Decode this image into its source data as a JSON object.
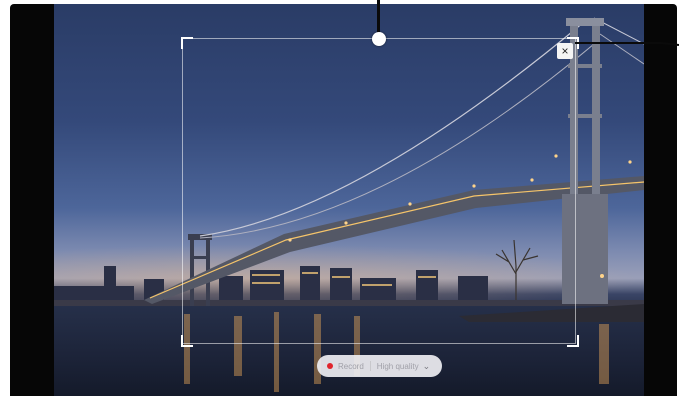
{
  "toolbar": {
    "record_label": "Record",
    "quality_label": "High quality",
    "record_color": "#e0242c"
  },
  "controls": {
    "close_glyph": "×",
    "dropdown_glyph": "⌄"
  },
  "icons": [
    "move-handle-icon",
    "close-icon",
    "record-dot-icon",
    "chevron-down-icon"
  ]
}
